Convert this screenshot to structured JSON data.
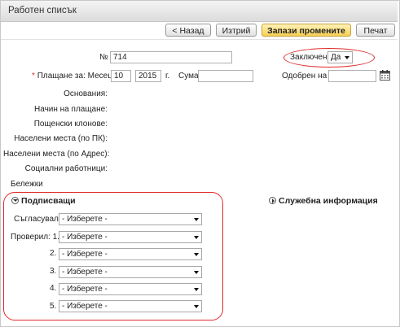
{
  "window": {
    "title": "Работен списък"
  },
  "toolbar": {
    "back_label": "< Назад",
    "delete_label": "Изтрий",
    "save_label": "Запази промените",
    "print_label": "Печат"
  },
  "form": {
    "number_label": "№",
    "number_value": "714",
    "locked_label": "Заключен",
    "locked_value": "Да",
    "payment_label": "Плащане за: Месец",
    "required_marker": "*",
    "month_value": "10",
    "year_value": "2015",
    "year_suffix": "г.",
    "amount_label": "Сума",
    "amount_value": "",
    "approved_label": "Одобрен на",
    "approved_value": "",
    "static_labels": {
      "basis": "Основания:",
      "payment_method": "Начин на плащане:",
      "post_branches": "Пощенски клонове:",
      "places_pk": "Населени места (по ПК):",
      "places_address": "Населени места (по Адрес):",
      "social_workers": "Социални работници:",
      "notes": "Бележки"
    }
  },
  "signers": {
    "title": "Подписващи",
    "agreed_label": "Съгласувал",
    "checked_label": "Проверил: 1.",
    "rows": [
      {
        "label": "",
        "value": "- Изберете -"
      },
      {
        "label": "",
        "value": "- Изберете -"
      },
      {
        "label": "2.",
        "value": "- Изберете -"
      },
      {
        "label": "3.",
        "value": "- Изберете -"
      },
      {
        "label": "4.",
        "value": "- Изберете -"
      },
      {
        "label": "5.",
        "value": "- Изберете -"
      }
    ]
  },
  "service_info": {
    "title": "Служебна информация"
  },
  "colors": {
    "highlight": "#e02a2a",
    "primary_button": "#f6cf55"
  }
}
